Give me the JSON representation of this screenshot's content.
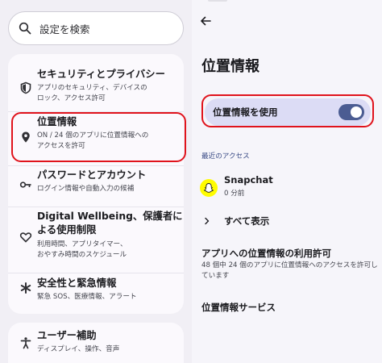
{
  "search": {
    "label": "設定を検索",
    "icon": "search-icon"
  },
  "sidebar": {
    "items": [
      {
        "title": "セキュリティとプライバシー",
        "subtitle_lines": [
          "アプリのセキュリティ、デバイスの",
          "ロック、アクセス許可"
        ],
        "icon": "shield-icon"
      },
      {
        "title": "位置情報",
        "subtitle_lines": [
          "ON / 24 個のアプリに位置情報への",
          "アクセスを許可"
        ],
        "icon": "location-pin-icon"
      },
      {
        "title": "パスワードとアカウント",
        "subtitle_lines": [
          "ログイン情報や自動入力の候補"
        ],
        "icon": "key-icon"
      },
      {
        "title_lines": [
          "Digital Wellbeing、保護者に",
          "よる使用制限"
        ],
        "subtitle_lines": [
          "利用時間、アプリタイマー、",
          "おやすみ時間のスケジュール"
        ],
        "icon": "wellbeing-heart-icon"
      },
      {
        "title": "安全性と緊急情報",
        "subtitle_lines": [
          "緊急 SOS、医療情報、アラート"
        ],
        "icon": "emergency-asterisk-icon"
      },
      {
        "title": "ユーザー補助",
        "subtitle_lines": [
          "ディスプレイ、操作、音声"
        ],
        "icon": "accessibility-icon"
      }
    ]
  },
  "location": {
    "title": "位置情報",
    "use_location_label": "位置情報を使用",
    "use_location_on": true,
    "recent_heading": "最近のアクセス",
    "recent_app": {
      "name": "Snapchat",
      "time": "0 分前",
      "icon": "snapchat-ghost-icon"
    },
    "show_all": "すべて表示",
    "perm_title": "アプリへの位置情報の利用許可",
    "perm_sub": "48 個中 24 個のアプリに位置情報へのアクセスを許可しています",
    "services_title": "位置情報サービス"
  },
  "colors": {
    "highlight": "#e0131c",
    "accent": "#4b5c92",
    "toggle_row_bg": "#dcdcf5",
    "snapchat_yellow": "#fffc00"
  }
}
